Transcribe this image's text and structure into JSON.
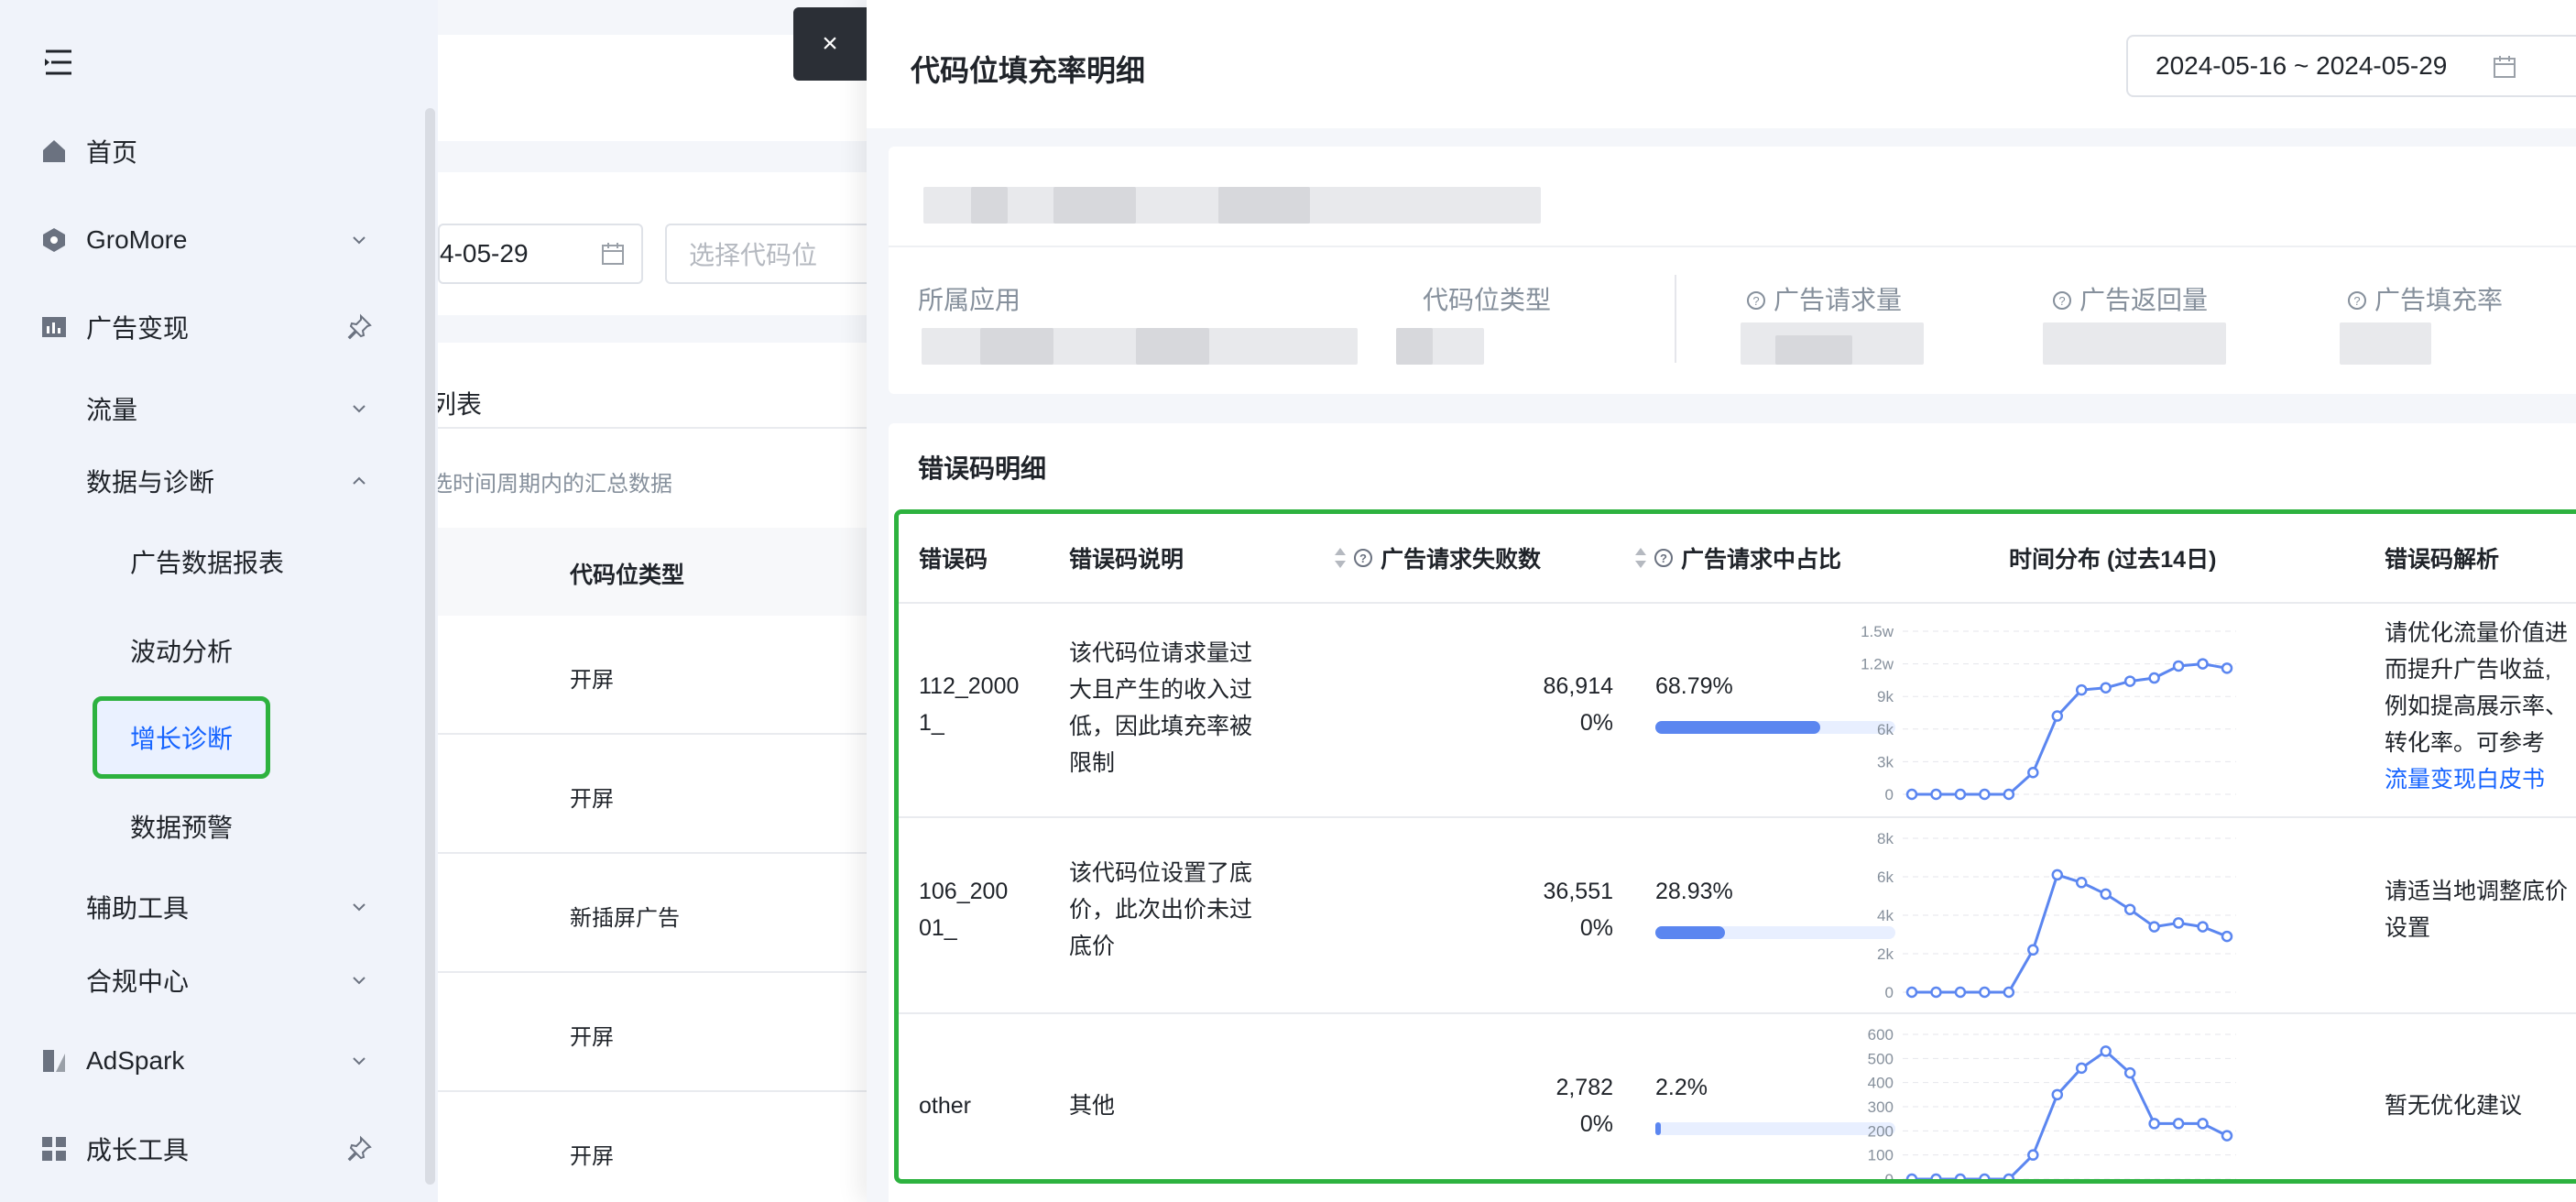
{
  "sidebar": {
    "items": [
      {
        "id": "home",
        "label": "首页",
        "icon": "home-icon"
      },
      {
        "id": "gromore",
        "label": "GroMore",
        "icon": "gromore-icon"
      },
      {
        "id": "monetize",
        "label": "广告变现",
        "icon": "bar-chart-icon"
      },
      {
        "id": "traffic",
        "label": "流量"
      },
      {
        "id": "data_diag",
        "label": "数据与诊断"
      },
      {
        "id": "ad_report",
        "label": "广告数据报表"
      },
      {
        "id": "fluct",
        "label": "波动分析"
      },
      {
        "id": "growth_diag",
        "label": "增长诊断"
      },
      {
        "id": "data_alert",
        "label": "数据预警"
      },
      {
        "id": "assist",
        "label": "辅助工具"
      },
      {
        "id": "compliance",
        "label": "合规中心"
      },
      {
        "id": "adspark",
        "label": "AdSpark",
        "icon": "adspark-icon"
      },
      {
        "id": "growth_tools",
        "label": "成长工具",
        "icon": "grid-icon"
      }
    ]
  },
  "background_page": {
    "date_partial": "4-05-29",
    "select_placeholder": "选择代码位",
    "list_title_partial": "列表",
    "summary_note_partial": "选时间周期内的汇总数据",
    "col_slot_type": "代码位类型",
    "rows": [
      "开屏",
      "开屏",
      "新插屏广告",
      "开屏",
      "开屏"
    ]
  },
  "drawer": {
    "close_label": "×",
    "title": "代码位填充率明细",
    "date_range": "2024-05-16 ~ 2024-05-29",
    "info_labels": {
      "app": "所属应用",
      "slot_type": "代码位类型",
      "requests": "广告请求量",
      "returns": "广告返回量",
      "fill_rate": "广告填充率"
    },
    "error_section": {
      "title": "错误码明细",
      "columns": {
        "code": "错误码",
        "desc": "错误码说明",
        "fail_count": "广告请求失败数",
        "share": "广告请求中占比",
        "dist": "时间分布 (过去14日)",
        "analysis": "错误码解析"
      },
      "rows": [
        {
          "code": "112_20001_",
          "desc": "该代码位请求量过大且产生的收入过低，因此填充率被限制",
          "fail_count": "86,914",
          "fail_change": "0%",
          "share": "68.79%",
          "share_value": 68.79,
          "analysis": "请优化流量价值进而提升广告收益,例如提高展示率、转化率。可参考",
          "analysis_link": "流量变现白皮书",
          "chart": {
            "y_ticks": [
              "0",
              "3k",
              "6k",
              "9k",
              "1.2w",
              "1.5w"
            ],
            "ymax": 15000,
            "values": [
              0,
              0,
              0,
              0,
              0,
              2000,
              7200,
              9600,
              9800,
              10400,
              10700,
              11800,
              12000,
              11600
            ]
          }
        },
        {
          "code": "106_20001_",
          "desc": "该代码位设置了底价，此次出价未过底价",
          "fail_count": "36,551",
          "fail_change": "0%",
          "share": "28.93%",
          "share_value": 28.93,
          "analysis": "请适当地调整底价设置",
          "analysis_link": "",
          "chart": {
            "y_ticks": [
              "0",
              "2k",
              "4k",
              "6k",
              "8k"
            ],
            "ymax": 8000,
            "values": [
              0,
              0,
              0,
              0,
              0,
              2200,
              6100,
              5700,
              5100,
              4300,
              3400,
              3600,
              3400,
              2900
            ]
          }
        },
        {
          "code": "other",
          "desc": "其他",
          "fail_count": "2,782",
          "fail_change": "0%",
          "share": "2.2%",
          "share_value": 2.2,
          "analysis": "暂无优化建议",
          "analysis_link": "",
          "chart": {
            "y_ticks": [
              "0",
              "100",
              "200",
              "300",
              "400",
              "500",
              "600"
            ],
            "ymax": 600,
            "values": [
              0,
              0,
              0,
              0,
              0,
              100,
              350,
              460,
              530,
              440,
              230,
              230,
              230,
              180
            ]
          }
        }
      ]
    }
  },
  "colors": {
    "accent": "#1664ff",
    "highlight": "#2db23f",
    "bar": "#5b86f0"
  }
}
